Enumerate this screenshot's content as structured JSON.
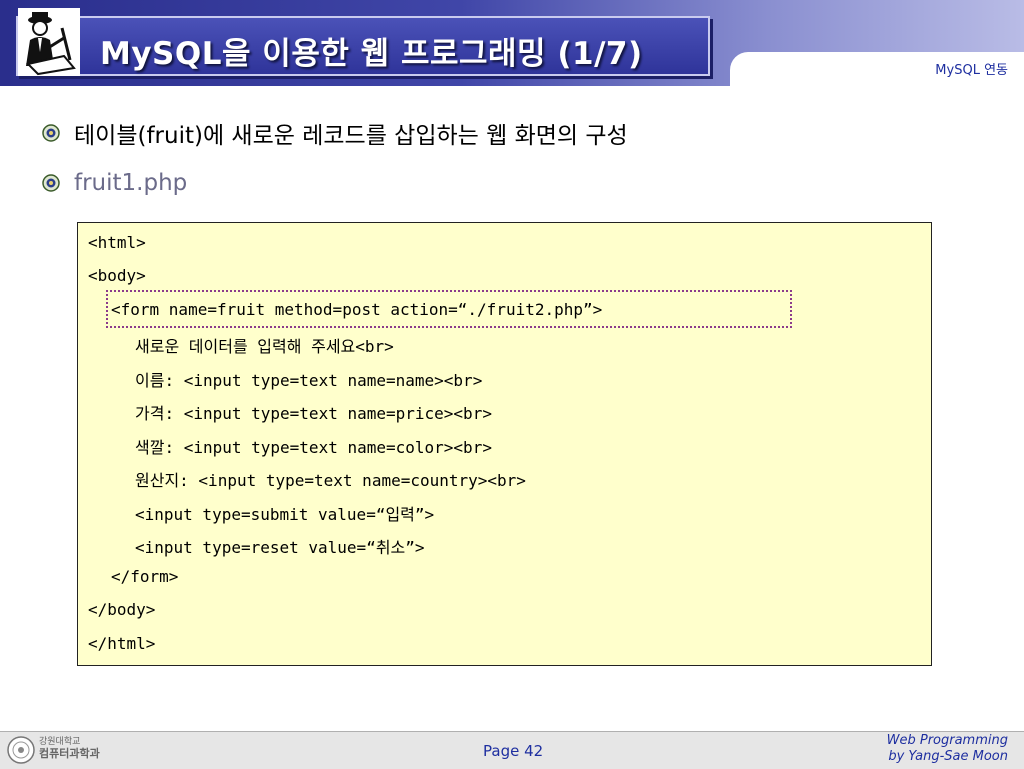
{
  "header": {
    "title": "MySQL을 이용한 웹 프로그래밍 (1/7)",
    "section_label": "MySQL 연동"
  },
  "bullets": [
    "테이블(fruit)에 새로운 레코드를 삽입하는 웹 화면의 구성",
    "fruit1.php"
  ],
  "code": [
    "<html>",
    "<body>",
    "<form name=fruit method=post action=“./fruit2.php”>",
    "새로운 데이터를 입력해 주세요<br>",
    "이름: <input type=text name=name><br>",
    "가격: <input type=text name=price><br>",
    "색깔: <input type=text name=color><br>",
    "원산지: <input type=text name=country><br>",
    "<input type=submit value=“입력”>",
    "<input type=reset value=“취소”>",
    "</form>",
    "</body>",
    "</html>"
  ],
  "footer": {
    "page": "Page 42",
    "credit_line1": "Web Programming",
    "credit_line2": "by Yang-Sae Moon",
    "logo_text_line1": "강원대학교",
    "logo_text_line2": "컴퓨터과학과"
  },
  "colors": {
    "header_dark": "#2a2e8c",
    "accent_text": "#1e2fa0",
    "code_bg": "#ffffcc",
    "highlight_border": "#8b3b8b"
  }
}
